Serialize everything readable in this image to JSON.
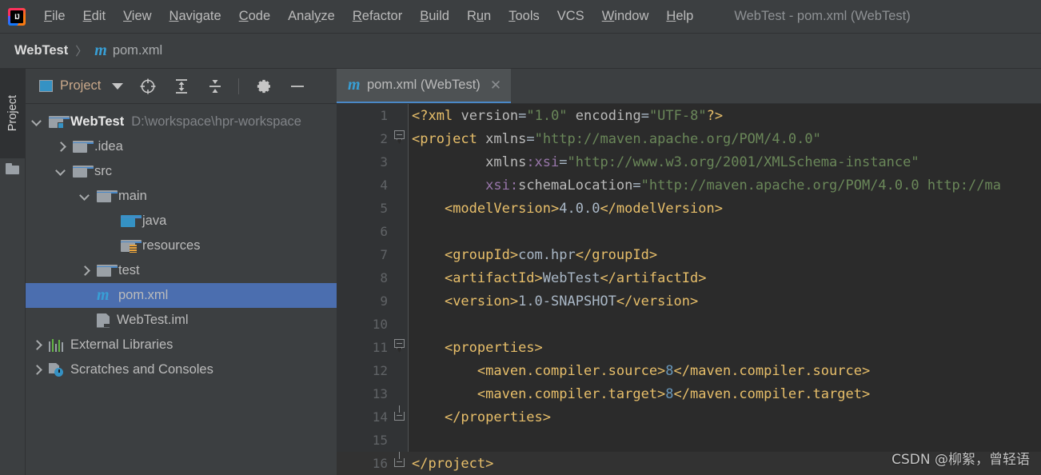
{
  "window": {
    "title": "WebTest - pom.xml (WebTest)",
    "logo_icon": "intellij-idea-logo"
  },
  "menubar": {
    "items": [
      {
        "label": "File",
        "mnemonic": "F"
      },
      {
        "label": "Edit",
        "mnemonic": "E"
      },
      {
        "label": "View",
        "mnemonic": "V"
      },
      {
        "label": "Navigate",
        "mnemonic": "N"
      },
      {
        "label": "Code",
        "mnemonic": "C"
      },
      {
        "label": "Analyze",
        "mnemonic": "y"
      },
      {
        "label": "Refactor",
        "mnemonic": "R"
      },
      {
        "label": "Build",
        "mnemonic": "B"
      },
      {
        "label": "Run",
        "mnemonic": "u"
      },
      {
        "label": "Tools",
        "mnemonic": "T"
      },
      {
        "label": "VCS",
        "mnemonic": ""
      },
      {
        "label": "Window",
        "mnemonic": "W"
      },
      {
        "label": "Help",
        "mnemonic": "H"
      }
    ]
  },
  "breadcrumb": {
    "project": "WebTest",
    "separator": "〉",
    "file": "pom.xml",
    "file_icon": "maven-m-icon"
  },
  "left_toolbar": {
    "tab_label": "Project",
    "folder_icon": "folder-icon"
  },
  "project_panel": {
    "toolbar": {
      "view_label": "Project",
      "view_icon": "project-view-icon",
      "dropdown_icon": "chevron-down-icon",
      "locate_icon": "scroll-from-source-icon",
      "expand_icon": "expand-all-icon",
      "collapse_icon": "collapse-all-icon",
      "settings_icon": "gear-icon",
      "hide_icon": "minimize-icon"
    },
    "tree": [
      {
        "depth": 0,
        "arrow": "down",
        "icon": "module-folder-icon",
        "label": "WebTest",
        "bold": true,
        "path": "D:\\workspace\\hpr-workspace",
        "selected": false
      },
      {
        "depth": 1,
        "arrow": "right",
        "icon": "folder-icon",
        "label": ".idea",
        "bold": false,
        "path": "",
        "selected": false
      },
      {
        "depth": 1,
        "arrow": "down",
        "icon": "folder-icon",
        "label": "src",
        "bold": false,
        "path": "",
        "selected": false
      },
      {
        "depth": 2,
        "arrow": "down",
        "icon": "folder-icon",
        "label": "main",
        "bold": false,
        "path": "",
        "selected": false
      },
      {
        "depth": 3,
        "arrow": "none",
        "icon": "source-folder-icon",
        "label": "java",
        "bold": false,
        "path": "",
        "selected": false
      },
      {
        "depth": 3,
        "arrow": "none",
        "icon": "resource-folder-icon",
        "label": "resources",
        "bold": false,
        "path": "",
        "selected": false
      },
      {
        "depth": 2,
        "arrow": "right",
        "icon": "folder-icon",
        "label": "test",
        "bold": false,
        "path": "",
        "selected": false
      },
      {
        "depth": 2,
        "arrow": "none",
        "icon": "maven-m-icon",
        "label": "pom.xml",
        "bold": false,
        "path": "",
        "selected": true
      },
      {
        "depth": 2,
        "arrow": "none",
        "icon": "iml-file-icon",
        "label": "WebTest.iml",
        "bold": false,
        "path": "",
        "selected": false
      },
      {
        "depth": 0,
        "arrow": "right",
        "icon": "libraries-icon",
        "label": "External Libraries",
        "bold": false,
        "path": "",
        "selected": false
      },
      {
        "depth": 0,
        "arrow": "right",
        "icon": "scratches-icon",
        "label": "Scratches and Consoles",
        "bold": false,
        "path": "",
        "selected": false
      }
    ]
  },
  "editor": {
    "tab": {
      "title": "pom.xml (WebTest)",
      "icon": "maven-m-icon",
      "close_icon": "close-icon"
    },
    "lines": [
      {
        "num": 1,
        "fold": "none",
        "caret": false,
        "tokens": [
          {
            "c": "tg",
            "t": "<?"
          },
          {
            "c": "tg",
            "t": "xml"
          },
          {
            "c": "vl",
            "t": " "
          },
          {
            "c": "at",
            "t": "version"
          },
          {
            "c": "vl",
            "t": "="
          },
          {
            "c": "st",
            "t": "\"1.0\""
          },
          {
            "c": "vl",
            "t": " "
          },
          {
            "c": "at",
            "t": "encoding"
          },
          {
            "c": "vl",
            "t": "="
          },
          {
            "c": "st",
            "t": "\"UTF-8\""
          },
          {
            "c": "tg",
            "t": "?>"
          }
        ]
      },
      {
        "num": 2,
        "fold": "start",
        "caret": false,
        "tokens": [
          {
            "c": "tg",
            "t": "<project"
          },
          {
            "c": "vl",
            "t": " "
          },
          {
            "c": "at",
            "t": "xmlns"
          },
          {
            "c": "vl",
            "t": "="
          },
          {
            "c": "st",
            "t": "\"http://maven.apache.org/POM/4.0.0\""
          }
        ]
      },
      {
        "num": 3,
        "fold": "bar",
        "caret": false,
        "tokens": [
          {
            "c": "vl",
            "t": "         "
          },
          {
            "c": "at",
            "t": "xmlns"
          },
          {
            "c": "ns",
            "t": ":xsi"
          },
          {
            "c": "vl",
            "t": "="
          },
          {
            "c": "st",
            "t": "\"http://www.w3.org/2001/XMLSchema-instance\""
          }
        ]
      },
      {
        "num": 4,
        "fold": "bar",
        "caret": false,
        "tokens": [
          {
            "c": "vl",
            "t": "         "
          },
          {
            "c": "ns",
            "t": "xsi:"
          },
          {
            "c": "at",
            "t": "schemaLocation"
          },
          {
            "c": "vl",
            "t": "="
          },
          {
            "c": "st",
            "t": "\"http://maven.apache.org/POM/4.0.0 http://ma"
          }
        ]
      },
      {
        "num": 5,
        "fold": "bar",
        "caret": false,
        "tokens": [
          {
            "c": "vl",
            "t": "    "
          },
          {
            "c": "tg",
            "t": "<modelVersion>"
          },
          {
            "c": "vl",
            "t": "4.0.0"
          },
          {
            "c": "tg",
            "t": "</modelVersion>"
          }
        ]
      },
      {
        "num": 6,
        "fold": "bar",
        "caret": false,
        "tokens": []
      },
      {
        "num": 7,
        "fold": "bar",
        "caret": false,
        "tokens": [
          {
            "c": "vl",
            "t": "    "
          },
          {
            "c": "tg",
            "t": "<groupId>"
          },
          {
            "c": "vl",
            "t": "com.hpr"
          },
          {
            "c": "tg",
            "t": "</groupId>"
          }
        ]
      },
      {
        "num": 8,
        "fold": "bar",
        "caret": false,
        "tokens": [
          {
            "c": "vl",
            "t": "    "
          },
          {
            "c": "tg",
            "t": "<artifactId>"
          },
          {
            "c": "vl",
            "t": "WebTest"
          },
          {
            "c": "tg",
            "t": "</artifactId>"
          }
        ]
      },
      {
        "num": 9,
        "fold": "bar",
        "caret": false,
        "tokens": [
          {
            "c": "vl",
            "t": "    "
          },
          {
            "c": "tg",
            "t": "<version>"
          },
          {
            "c": "vl",
            "t": "1.0-SNAPSHOT"
          },
          {
            "c": "tg",
            "t": "</version>"
          }
        ]
      },
      {
        "num": 10,
        "fold": "bar",
        "caret": false,
        "tokens": []
      },
      {
        "num": 11,
        "fold": "start2",
        "caret": false,
        "tokens": [
          {
            "c": "vl",
            "t": "    "
          },
          {
            "c": "tg",
            "t": "<properties>"
          }
        ]
      },
      {
        "num": 12,
        "fold": "bar2",
        "caret": false,
        "tokens": [
          {
            "c": "vl",
            "t": "        "
          },
          {
            "c": "tg",
            "t": "<maven.compiler.source>"
          },
          {
            "c": "nm",
            "t": "8"
          },
          {
            "c": "tg",
            "t": "</maven.compiler.source>"
          }
        ]
      },
      {
        "num": 13,
        "fold": "bar2",
        "caret": false,
        "tokens": [
          {
            "c": "vl",
            "t": "        "
          },
          {
            "c": "tg",
            "t": "<maven.compiler.target>"
          },
          {
            "c": "nm",
            "t": "8"
          },
          {
            "c": "tg",
            "t": "</maven.compiler.target>"
          }
        ]
      },
      {
        "num": 14,
        "fold": "end2",
        "caret": false,
        "tokens": [
          {
            "c": "vl",
            "t": "    "
          },
          {
            "c": "tg",
            "t": "</properties>"
          }
        ]
      },
      {
        "num": 15,
        "fold": "bar",
        "caret": false,
        "tokens": []
      },
      {
        "num": 16,
        "fold": "end",
        "caret": true,
        "tokens": [
          {
            "c": "tg",
            "t": "</project>"
          }
        ]
      }
    ]
  },
  "watermark": {
    "text": "CSDN @柳絮，曾轻语"
  },
  "colors": {
    "chrome_bg": "#3c3f41",
    "editor_bg": "#2b2b2b",
    "gutter_bg": "#313335",
    "selection_blue": "#4b6eaf",
    "tab_underline": "#4a88c7",
    "maven_blue": "#389fd6",
    "xml_tag": "#e8bf6a",
    "xml_string": "#6a8759",
    "xml_ns": "#9876aa",
    "xml_number": "#6897bb",
    "text_primary": "#bbbbbb",
    "text_muted": "#808387"
  }
}
